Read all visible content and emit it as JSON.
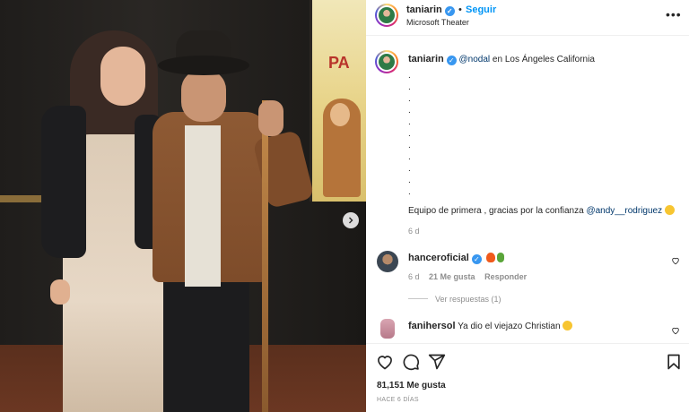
{
  "post": {
    "author": "taniarin",
    "follow_label": "Seguir",
    "separator": "•",
    "location": "Microsoft Theater",
    "more_label": "•••"
  },
  "caption": {
    "author": "taniarin",
    "mention": "@nodal",
    "text_after_mention": " en Los Ángeles California",
    "dots": [
      ".",
      ".",
      ".",
      ".",
      ".",
      ".",
      ".",
      ".",
      ".",
      ".",
      "."
    ],
    "last_line_text": "Equipo de primera , gracias por la confianza ",
    "last_line_mention": "@andy__rodriguez",
    "time": "6 d"
  },
  "comments": [
    {
      "author": "hanceroficial",
      "time": "6 d",
      "likes": "21 Me gusta",
      "reply_label": "Responder",
      "view_replies": "Ver respuestas (1)"
    },
    {
      "author": "fanihersol",
      "text": "Ya dio el viejazo Christian"
    }
  ],
  "actions": {
    "likes": "81,151 Me gusta",
    "posted_ago": "HACE 6 DÍAS"
  },
  "poster": {
    "text": "PA"
  },
  "icons": {
    "verified": "verified-badge-icon",
    "next": "chevron-right-icon",
    "like": "heart-icon",
    "comment": "comment-icon",
    "share": "share-icon",
    "save": "bookmark-icon"
  },
  "colors": {
    "accent": "#0095f6",
    "verified": "#3897f0",
    "mention": "#00376b"
  }
}
